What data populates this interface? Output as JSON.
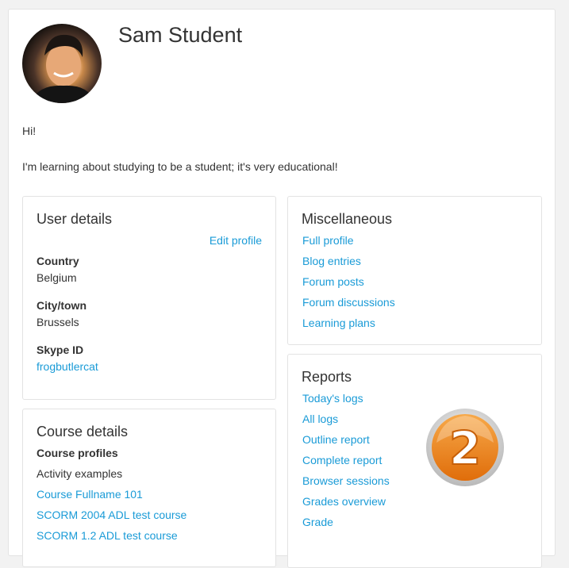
{
  "profile": {
    "name": "Sam Student",
    "description_lines": [
      "Hi!",
      "I'm learning about studying to be a student; it's very educational!"
    ]
  },
  "user_details": {
    "title": "User details",
    "edit_link": "Edit profile",
    "fields": [
      {
        "label": "Country",
        "value": "Belgium"
      },
      {
        "label": "City/town",
        "value": "Brussels"
      },
      {
        "label": "Skype ID",
        "value": "frogbutlercat"
      }
    ]
  },
  "course_details": {
    "title": "Course details",
    "subtitle": "Course profiles",
    "courses": [
      "Activity examples",
      "Course Fullname 101",
      "SCORM 2004 ADL test course",
      "SCORM 1.2 ADL test course"
    ]
  },
  "miscellaneous": {
    "title": "Miscellaneous",
    "links": [
      "Full profile",
      "Blog entries",
      "Forum posts",
      "Forum discussions",
      "Learning plans"
    ]
  },
  "reports": {
    "title": "Reports",
    "links": [
      "Today's logs",
      "All logs",
      "Outline report",
      "Complete report",
      "Browser sessions",
      "Grades overview",
      "Grade"
    ],
    "badge_number": "2"
  },
  "colors": {
    "link": "#1a9bd7",
    "badge": "#f08a1c"
  }
}
